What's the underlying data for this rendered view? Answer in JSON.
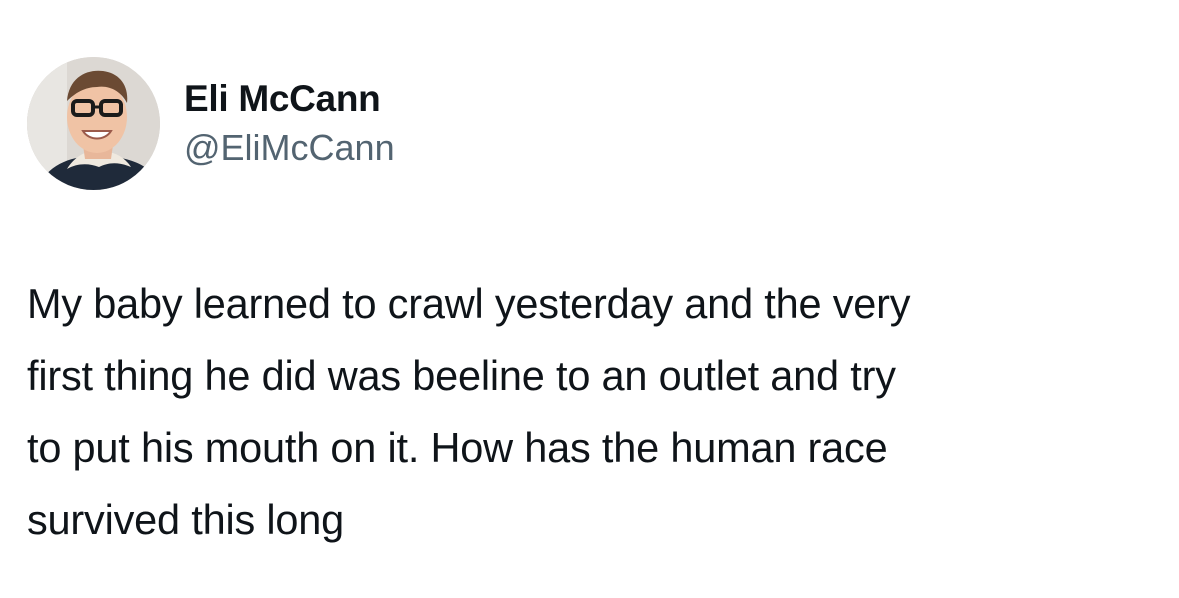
{
  "author": {
    "display_name": "Eli McCann",
    "handle": "@EliMcCann",
    "avatar_icon": "profile-photo"
  },
  "tweet": {
    "text": "My baby learned to crawl yesterday and the very\nfirst thing he did was beeline to an outlet and try\nto put his mouth on it. How has the human race\nsurvived this long"
  },
  "colors": {
    "background": "#ffffff",
    "primary_text": "#0f1419",
    "secondary_text": "#536471"
  }
}
